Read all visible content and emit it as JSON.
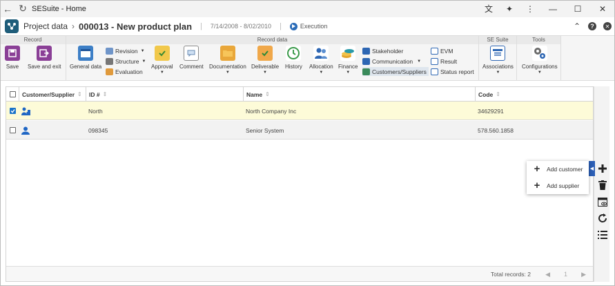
{
  "window": {
    "title": "SESuite - Home"
  },
  "header": {
    "breadcrumb": "Project data",
    "title": "000013 - New product plan",
    "date_range": "7/14/2008 - 8/02/2010",
    "status": "Execution"
  },
  "ribbon": {
    "groups": {
      "record": "Record",
      "record_data": "Record data",
      "se_suite": "SE Suite",
      "tools": "Tools"
    },
    "buttons": {
      "save": "Save",
      "save_exit": "Save and exit",
      "general_data": "General data",
      "approval": "Approval",
      "comment": "Comment",
      "documentation": "Documentation",
      "deliverable": "Deliverable",
      "history": "History",
      "allocation": "Allocation",
      "finance": "Finance",
      "associations": "Associations",
      "configurations": "Configurations"
    },
    "small": {
      "revision": "Revision",
      "structure": "Structure",
      "evaluation": "Evaluation",
      "stakeholder": "Stakeholder",
      "communication": "Communication",
      "customers_suppliers": "Customers/Suppliers",
      "evm": "EVM",
      "result": "Result",
      "status_report": "Status report"
    }
  },
  "grid": {
    "columns": [
      "Customer/Supplier",
      "ID #",
      "Name",
      "Code"
    ],
    "rows": [
      {
        "checked": true,
        "id": "North",
        "name": "North Company Inc",
        "code": "34629291"
      },
      {
        "checked": false,
        "id": "098345",
        "name": "Senior System",
        "code": "578.560.1858"
      }
    ],
    "footer": {
      "total_records": "Total records: 2",
      "page": "1"
    }
  },
  "popup": {
    "add_customer": "Add customer",
    "add_supplier": "Add supplier"
  },
  "colors": {
    "accent": "#2c5fb6",
    "selected_row": "#fdfbd8",
    "logo": "#1f5d7a"
  }
}
